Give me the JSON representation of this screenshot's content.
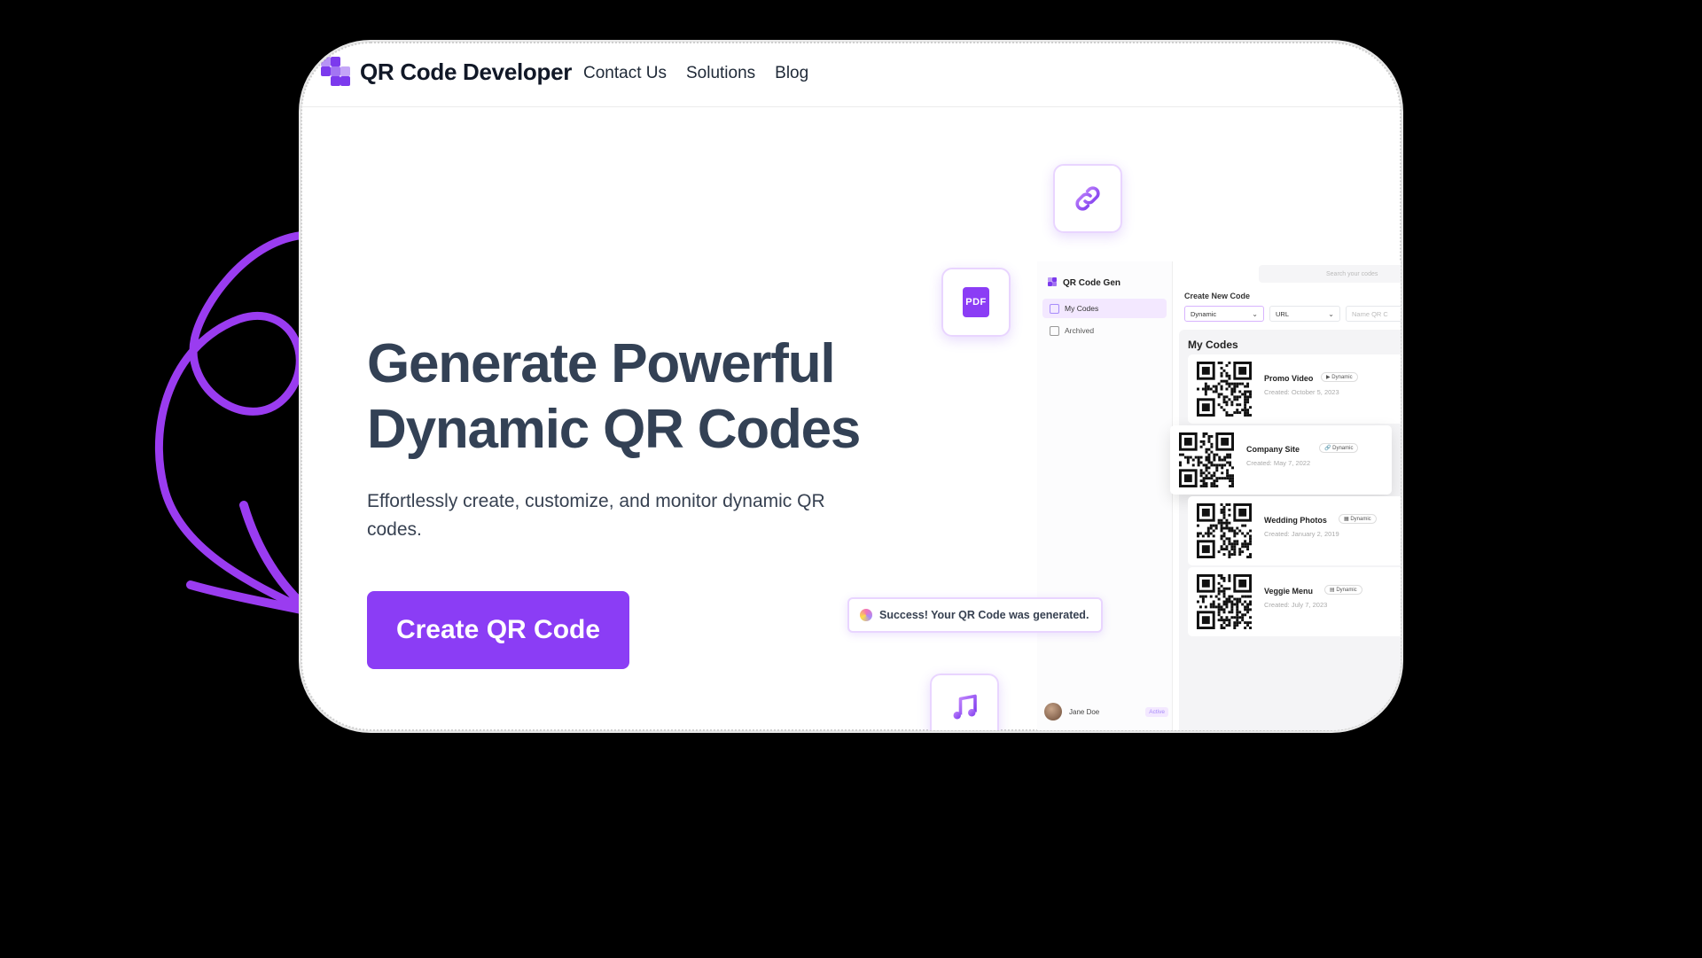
{
  "brand": {
    "name": "QR Code Developer",
    "accent": "#7c3aed"
  },
  "nav": [
    {
      "label": "Contact Us"
    },
    {
      "label": "Solutions"
    },
    {
      "label": "Blog"
    }
  ],
  "hero": {
    "title_line1": "Generate Powerful",
    "title_line2": "Dynamic QR Codes",
    "subtitle": "Effortlessly create, customize, and monitor dynamic QR codes.",
    "cta_label": "Create QR Code",
    "cta_color": "#8b3df5"
  },
  "tiles": {
    "link_icon": "link-icon",
    "pdf_label": "PDF",
    "music_icon": "music-note-icon"
  },
  "toast": {
    "text": "Success! Your QR Code was generated."
  },
  "app": {
    "brand": "QR Code Gen",
    "search_placeholder": "Search your codes",
    "sidebar": [
      {
        "label": "My Codes",
        "active": true
      },
      {
        "label": "Archived",
        "active": false
      }
    ],
    "user": {
      "name": "Jane Doe",
      "badge": "Active"
    },
    "create_label": "Create New Code",
    "selects": {
      "type": "Dynamic",
      "content": "URL",
      "name_placeholder": "Name QR C"
    },
    "codes_title": "My Codes",
    "codes": [
      {
        "name": "Promo Video",
        "tag": "▶ Dynamic",
        "date": "Created: October 5, 2023"
      },
      {
        "name": "Company Site",
        "tag": "🔗 Dynamic",
        "date": "Created: May 7, 2022"
      },
      {
        "name": "Wedding Photos",
        "tag": "▦ Dynamic",
        "date": "Created: January 2, 2019"
      },
      {
        "name": "Veggie Menu",
        "tag": "▤ Dynamic",
        "date": "Created: July 7, 2023"
      }
    ]
  }
}
